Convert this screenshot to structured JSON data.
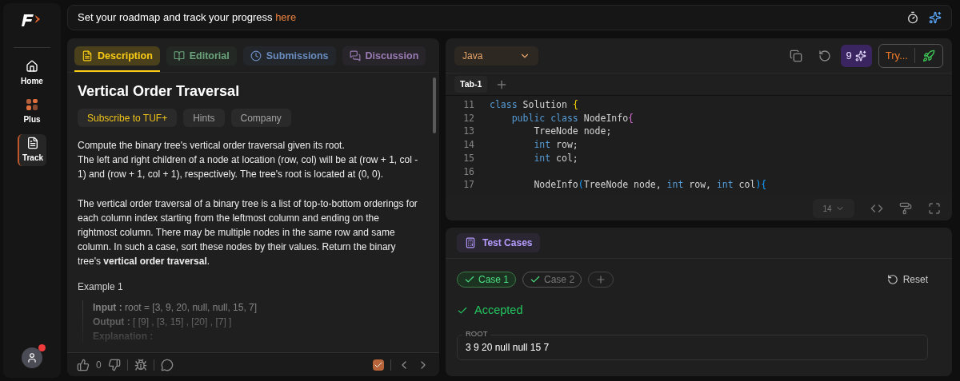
{
  "banner": {
    "text": "Set your roadmap and track your progress",
    "link": "here"
  },
  "sidebar": {
    "items": [
      {
        "label": "Home",
        "kind": "home",
        "selected": false
      },
      {
        "label": "Plus",
        "kind": "plus",
        "selected": false
      },
      {
        "label": "Track",
        "kind": "track",
        "selected": true
      }
    ],
    "avatar_notification": true
  },
  "tabs": [
    {
      "label": "Description",
      "kind": "description",
      "color": "#facc15",
      "selected": true
    },
    {
      "label": "Editorial",
      "kind": "editorial",
      "color": "#6aa37a",
      "selected": false
    },
    {
      "label": "Submissions",
      "kind": "submissions",
      "color": "#6a8cc0",
      "selected": false
    },
    {
      "label": "Discussion",
      "kind": "discussion",
      "color": "#9a7bb5",
      "selected": false
    }
  ],
  "problem": {
    "title": "Vertical Order Traversal",
    "chips": [
      {
        "label": "Subscribe to TUF+",
        "kind": "premium"
      },
      {
        "label": "Hints",
        "kind": "plain"
      },
      {
        "label": "Company",
        "kind": "plain"
      }
    ],
    "paragraphs": [
      "Compute the binary tree's vertical order traversal given its root.\nThe left and right children of a node at location (row, col) will be at (row + 1, col - 1) and (row + 1, col + 1), respectively. The tree's root is located at (0, 0).",
      "The vertical order traversal of a binary tree is a list of top-to-bottom orderings for each column index starting from the leftmost column and ending on the rightmost column. There may be multiple nodes in the same row and same column. In such a case, sort these nodes by their values. Return the binary tree's **vertical order traversal**."
    ],
    "example_title": "Example 1",
    "example_lines": [
      {
        "label": "Input :",
        "value": "root = [3, 9, 20, null, null, 15, 7]"
      },
      {
        "label": "Output :",
        "value": "[ [9] , [3, 15] , [20] , [7] ]"
      },
      {
        "label": "Explanation :"
      }
    ]
  },
  "footer": {
    "likes": "0",
    "solved": true
  },
  "editor": {
    "language": "Java",
    "credits": "9",
    "try_label": "Try...",
    "tabs": [
      {
        "label": "Tab-1",
        "selected": true
      }
    ],
    "font_size": "14",
    "lines": [
      {
        "number": "11",
        "tokens": [
          {
            "text": "class",
            "kind": "keyword"
          },
          {
            "text": " Solution ",
            "kind": "plain"
          },
          {
            "text": "{",
            "kind": "brace"
          }
        ]
      },
      {
        "number": "12",
        "tokens": [
          {
            "text": "    public class",
            "kind": "keyword"
          },
          {
            "text": " NodeInfo",
            "kind": "plain"
          },
          {
            "text": "{",
            "kind": "brace2"
          }
        ]
      },
      {
        "number": "13",
        "tokens": [
          {
            "text": "        TreeNode node;",
            "kind": "plain"
          }
        ]
      },
      {
        "number": "14",
        "tokens": [
          {
            "text": "        int",
            "kind": "keyword"
          },
          {
            "text": " row;",
            "kind": "plain"
          }
        ]
      },
      {
        "number": "15",
        "tokens": [
          {
            "text": "        int",
            "kind": "keyword"
          },
          {
            "text": " col;",
            "kind": "plain"
          }
        ]
      },
      {
        "number": "16"
      },
      {
        "number": "17",
        "tokens": [
          {
            "text": "        NodeInfo",
            "kind": "plain"
          },
          {
            "text": "(",
            "kind": "brace3"
          },
          {
            "text": "TreeNode node, ",
            "kind": "plain"
          },
          {
            "text": "int",
            "kind": "keyword"
          },
          {
            "text": " row, ",
            "kind": "plain"
          },
          {
            "text": "int",
            "kind": "keyword"
          },
          {
            "text": " col",
            "kind": "plain"
          },
          {
            "text": "){",
            "kind": "brace3"
          }
        ]
      }
    ]
  },
  "tests": {
    "title": "Test Cases",
    "cases": [
      {
        "label": "Case 1",
        "selected": true,
        "passed": true
      },
      {
        "label": "Case 2",
        "selected": false,
        "passed": true
      }
    ],
    "reset": "Reset",
    "status": "Accepted",
    "field_label": "ROOT",
    "field_value": "3 9 20 null null 15 7"
  }
}
